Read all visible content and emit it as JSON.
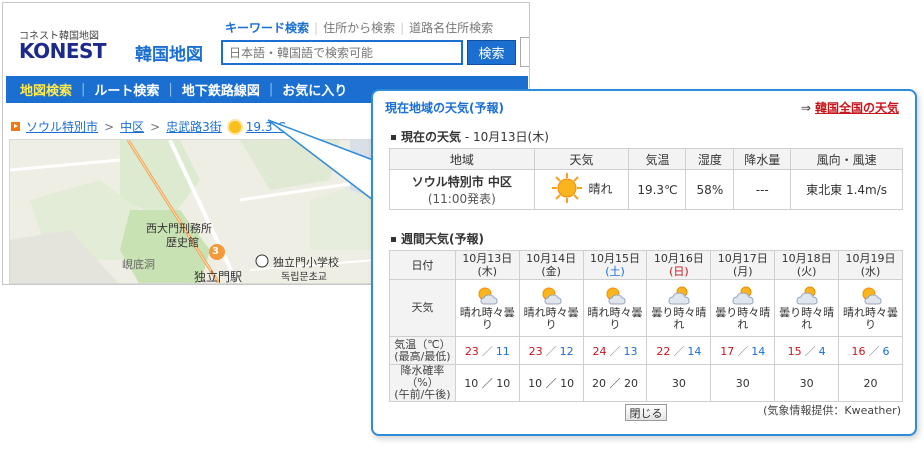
{
  "header": {
    "logo_sub": "コネスト韓国地図",
    "logo_main": "KONEST",
    "logo_sub2": "韓国地図",
    "search_tabs": [
      "キーワード検索",
      "住所から検索",
      "道路名住所検索"
    ],
    "search_placeholder": "日本語・韓国語で検索可能",
    "search_button": "検索"
  },
  "nav": {
    "items": [
      "地図検索",
      "ルート検索",
      "地下鉄路線図",
      "お気に入り"
    ]
  },
  "breadcrumb": {
    "items": [
      "ソウル特別市",
      "中区",
      "忠武路3街"
    ],
    "temp": "19.3℃"
  },
  "map": {
    "labels": [
      "西大門刑務所",
      "歴史館",
      "峴底洞",
      "独立門駅",
      "独立門小学校",
      "독립문초교",
      "3"
    ]
  },
  "popup": {
    "title": "現在地域の天気(予報)",
    "link_arrow": "⇒",
    "link_label": "韓国全国の天気",
    "current_title": "現在の天気",
    "current_date": " - 10月13日(木)",
    "current_headers": [
      "地域",
      "天気",
      "気温",
      "湿度",
      "降水量",
      "風向・風速"
    ],
    "current": {
      "region": "ソウル特別市 中区",
      "time": "(11:00発表)",
      "weather": "晴れ",
      "temp": "19.3℃",
      "humidity": "58%",
      "rain": "---",
      "wind": "東北東 1.4m/s"
    },
    "weekly_title": "週間天気(予報)",
    "weekly_row_labels": {
      "date": "日付",
      "weather": "天気",
      "temp_1": "気温（℃）",
      "temp_2": "(最高/最低)",
      "rain_1": "降水確率（%）",
      "rain_2": "(午前/午後)"
    },
    "weekly": [
      {
        "date": "10月13日",
        "dow": "(木)",
        "weather_1": "晴れ時々曇",
        "weather_2": "り",
        "icon": "sun-cloud-icon",
        "hi": "23",
        "lo": "11",
        "rain": "10 ／ 10"
      },
      {
        "date": "10月14日",
        "dow": "(金)",
        "weather_1": "晴れ時々曇",
        "weather_2": "り",
        "icon": "sun-cloud-icon",
        "hi": "23",
        "lo": "12",
        "rain": "10 ／ 10"
      },
      {
        "date": "10月15日",
        "dow": "(土)",
        "weather_1": "晴れ時々曇",
        "weather_2": "り",
        "icon": "sun-cloud-icon",
        "hi": "24",
        "lo": "13",
        "rain": "20 ／ 20"
      },
      {
        "date": "10月16日",
        "dow": "(日)",
        "weather_1": "曇り時々晴",
        "weather_2": "れ",
        "icon": "cloud-sun-icon",
        "hi": "22",
        "lo": "14",
        "rain": "30"
      },
      {
        "date": "10月17日",
        "dow": "(月)",
        "weather_1": "曇り時々晴",
        "weather_2": "れ",
        "icon": "cloud-sun-icon",
        "hi": "17",
        "lo": "14",
        "rain": "30"
      },
      {
        "date": "10月18日",
        "dow": "(火)",
        "weather_1": "曇り時々晴",
        "weather_2": "れ",
        "icon": "cloud-sun-icon",
        "hi": "15",
        "lo": "4",
        "rain": "30"
      },
      {
        "date": "10月19日",
        "dow": "(水)",
        "weather_1": "晴れ時々曇",
        "weather_2": "り",
        "icon": "sun-cloud-icon",
        "hi": "16",
        "lo": "6",
        "rain": "20"
      }
    ],
    "temp_sep": "／",
    "close_button": "閉じる",
    "credit": "(気象情報提供：Kweather)"
  },
  "colors": {
    "brand_blue": "#1a6fd1",
    "highlight_yellow": "#ffe94b",
    "hi_red": "#c8161d",
    "popup_border": "#2e8cd8"
  }
}
